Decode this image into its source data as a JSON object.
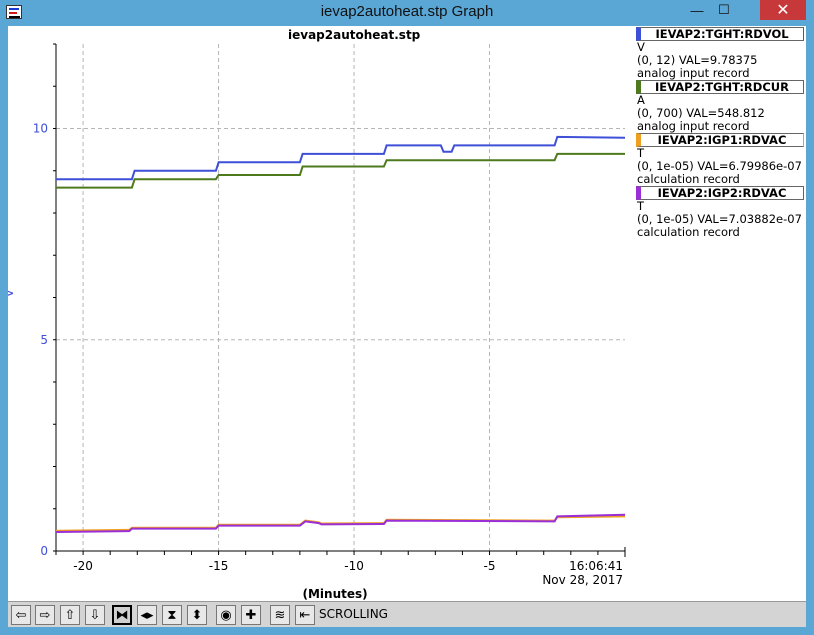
{
  "window": {
    "title": "ievap2autoheat.stp Graph"
  },
  "titlebar_buttons": {
    "minimize": "—",
    "maximize": "☐",
    "close": "✕"
  },
  "plot": {
    "title": "ievap2autoheat.stp"
  },
  "chart_data": {
    "type": "line",
    "x_label": "(Minutes)",
    "y_label": "V",
    "xlim": [
      -21,
      0
    ],
    "ylim": [
      0,
      12
    ],
    "x_ticks": [
      -20,
      -15,
      -10,
      -5
    ],
    "x_tick_labels": [
      "-20",
      "-15",
      "-10",
      "-5"
    ],
    "y_ticks": [
      0,
      5,
      10
    ],
    "y_tick_labels": [
      "0",
      "5",
      "10"
    ],
    "time_label": "16:06:41",
    "date_label": "Nov 28, 2017",
    "grid": true,
    "series": [
      {
        "name": "IEVAP2:TGHT:RDVOL",
        "color": "#3e4fd8",
        "x": [
          -21,
          -18.2,
          -18.1,
          -15.1,
          -15.0,
          -12.0,
          -11.9,
          -8.9,
          -8.8,
          -6.8,
          -6.7,
          -6.4,
          -6.3,
          -2.6,
          -2.5,
          0
        ],
        "y": [
          8.8,
          8.8,
          9.0,
          9.0,
          9.2,
          9.2,
          9.4,
          9.4,
          9.6,
          9.6,
          9.45,
          9.45,
          9.6,
          9.6,
          9.8,
          9.78
        ]
      },
      {
        "name": "IEVAP2:TGHT:RDCUR",
        "color": "#4e7a1e",
        "x": [
          -21,
          -18.2,
          -18.1,
          -15.1,
          -15.0,
          -12.0,
          -11.9,
          -8.9,
          -8.8,
          -2.6,
          -2.5,
          0
        ],
        "y": [
          8.6,
          8.6,
          8.8,
          8.8,
          8.9,
          8.9,
          9.1,
          9.1,
          9.25,
          9.25,
          9.4,
          9.4
        ]
      },
      {
        "name": "IEVAP2:IGP1:RDVAC",
        "color": "#f0a020",
        "x": [
          -21,
          -18.3,
          -18.2,
          -15.1,
          -15.0,
          -12.0,
          -11.8,
          -11.3,
          -11.2,
          -8.9,
          -8.8,
          -2.6,
          -2.5,
          0
        ],
        "y": [
          0.48,
          0.5,
          0.55,
          0.55,
          0.62,
          0.62,
          0.72,
          0.68,
          0.65,
          0.66,
          0.74,
          0.72,
          0.8,
          0.82
        ]
      },
      {
        "name": "IEVAP2:IGP2:RDVAC",
        "color": "#9a2fd8",
        "x": [
          -21,
          -18.3,
          -18.2,
          -15.1,
          -15.0,
          -12.0,
          -11.8,
          -11.3,
          -11.2,
          -8.9,
          -8.8,
          -2.6,
          -2.5,
          0
        ],
        "y": [
          0.45,
          0.47,
          0.53,
          0.53,
          0.6,
          0.6,
          0.7,
          0.66,
          0.63,
          0.64,
          0.72,
          0.7,
          0.82,
          0.86
        ]
      }
    ]
  },
  "legend": [
    {
      "name": "IEVAP2:TGHT:RDVOL",
      "color": "#3e4fd8",
      "unit": "V",
      "range_val": "(0, 12) VAL=9.78375",
      "record": "analog input record"
    },
    {
      "name": "IEVAP2:TGHT:RDCUR",
      "color": "#4e7a1e",
      "unit": "A",
      "range_val": "(0, 700) VAL=548.812",
      "record": "analog input record"
    },
    {
      "name": "IEVAP2:IGP1:RDVAC",
      "color": "#f0a020",
      "unit": "T",
      "range_val": "(0, 1e-05) VAL=6.79986e-07",
      "record": "calculation record"
    },
    {
      "name": "IEVAP2:IGP2:RDVAC",
      "color": "#9a2fd8",
      "unit": "T",
      "range_val": "(0, 1e-05) VAL=7.03882e-07",
      "record": "calculation record"
    }
  ],
  "toolbar": {
    "status": "SCROLLING",
    "icons": [
      "arrow-left-icon",
      "arrow-right-icon",
      "arrow-up-icon",
      "arrow-down-icon",
      "zoom-horizontal-in-icon",
      "zoom-horizontal-out-icon",
      "zoom-vertical-in-icon",
      "zoom-vertical-out-icon",
      "center-icon",
      "crosshair-icon",
      "stagger-icon",
      "scroll-mode-icon"
    ]
  }
}
